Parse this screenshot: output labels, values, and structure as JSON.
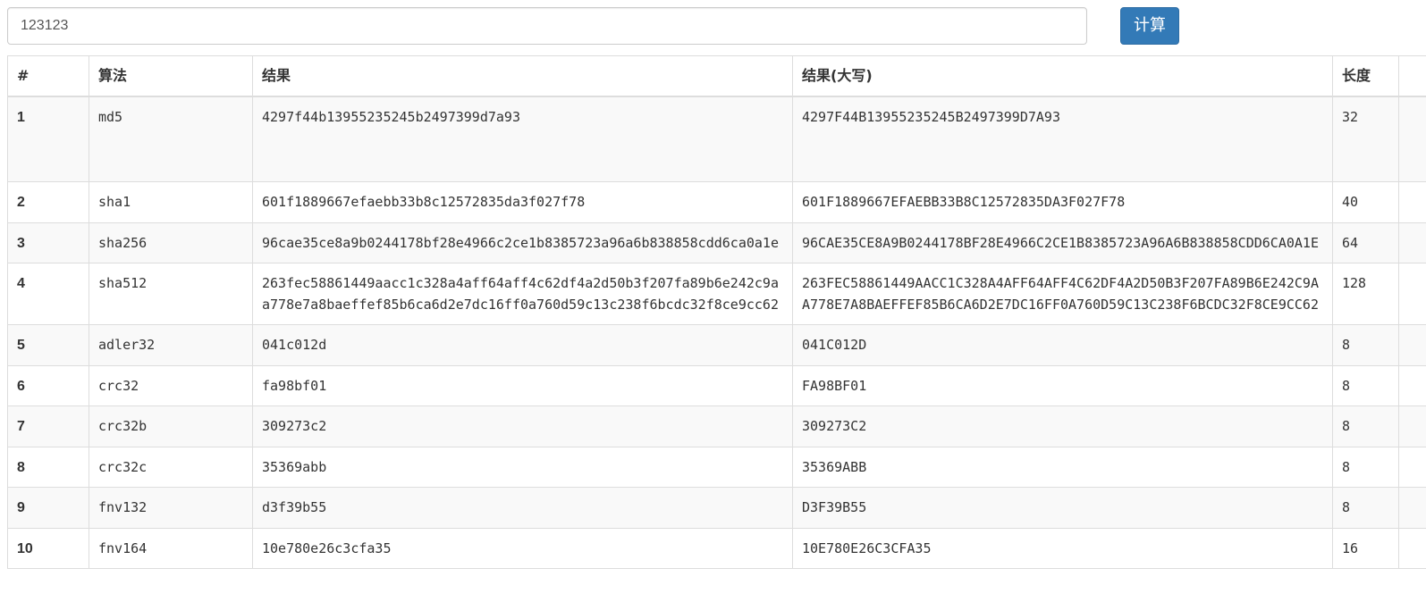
{
  "input": {
    "value": "123123"
  },
  "toolbar": {
    "calc_label": "计算"
  },
  "table": {
    "headers": {
      "num": "#",
      "algo": "算法",
      "result": "结果",
      "result_upper": "结果(大写)",
      "length": "长度"
    },
    "rows": [
      {
        "num": "1",
        "algo": "md5",
        "result": "4297f44b13955235245b2497399d7a93",
        "upper": "4297F44B13955235245B2497399D7A93",
        "length": "32"
      },
      {
        "num": "2",
        "algo": "sha1",
        "result": "601f1889667efaebb33b8c12572835da3f027f78",
        "upper": "601F1889667EFAEBB33B8C12572835DA3F027F78",
        "length": "40"
      },
      {
        "num": "3",
        "algo": "sha256",
        "result": "96cae35ce8a9b0244178bf28e4966c2ce1b8385723a96a6b838858cdd6ca0a1e",
        "upper": "96CAE35CE8A9B0244178BF28E4966C2CE1B8385723A96A6B838858CDD6CA0A1E",
        "length": "64"
      },
      {
        "num": "4",
        "algo": "sha512",
        "result": "263fec58861449aacc1c328a4aff64aff4c62df4a2d50b3f207fa89b6e242c9aa778e7a8baeffef85b6ca6d2e7dc16ff0a760d59c13c238f6bcdc32f8ce9cc62",
        "upper": "263FEC58861449AACC1C328A4AFF64AFF4C62DF4A2D50B3F207FA89B6E242C9AA778E7A8BAEFFEF85B6CA6D2E7DC16FF0A760D59C13C238F6BCDC32F8CE9CC62",
        "length": "128"
      },
      {
        "num": "5",
        "algo": "adler32",
        "result": "041c012d",
        "upper": "041C012D",
        "length": "8"
      },
      {
        "num": "6",
        "algo": "crc32",
        "result": "fa98bf01",
        "upper": "FA98BF01",
        "length": "8"
      },
      {
        "num": "7",
        "algo": "crc32b",
        "result": "309273c2",
        "upper": "309273C2",
        "length": "8"
      },
      {
        "num": "8",
        "algo": "crc32c",
        "result": "35369abb",
        "upper": "35369ABB",
        "length": "8"
      },
      {
        "num": "9",
        "algo": "fnv132",
        "result": "d3f39b55",
        "upper": "D3F39B55",
        "length": "8"
      },
      {
        "num": "10",
        "algo": "fnv164",
        "result": "10e780e26c3cfa35",
        "upper": "10E780E26C3CFA35",
        "length": "16"
      }
    ]
  },
  "colors": {
    "primary_button": "#337ab7",
    "table_border": "#dddddd",
    "stripe": "#f9f9f9"
  }
}
